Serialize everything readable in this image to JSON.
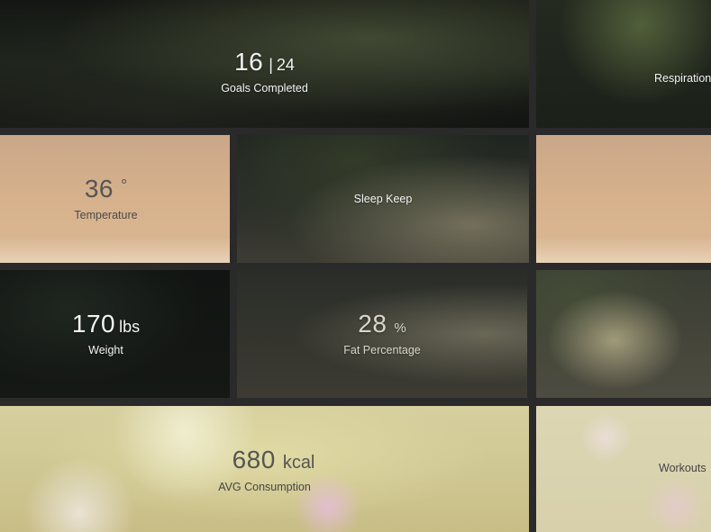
{
  "tiles": {
    "goals": {
      "value": "16",
      "total": "24",
      "label": "Goals Completed"
    },
    "respiration": {
      "label": "Respiration"
    },
    "temperature": {
      "value": "36",
      "unit": "°",
      "label": "Temperature"
    },
    "sleep": {
      "label": "Sleep Keep"
    },
    "weight": {
      "value": "170",
      "unit": "lbs",
      "label": "Weight"
    },
    "fat": {
      "value": "28",
      "unit": "%",
      "label": "Fat Percentage"
    },
    "consumption": {
      "value": "680",
      "unit": "kcal",
      "label": "AVG Consumption"
    },
    "workouts": {
      "label": "Workouts"
    }
  }
}
